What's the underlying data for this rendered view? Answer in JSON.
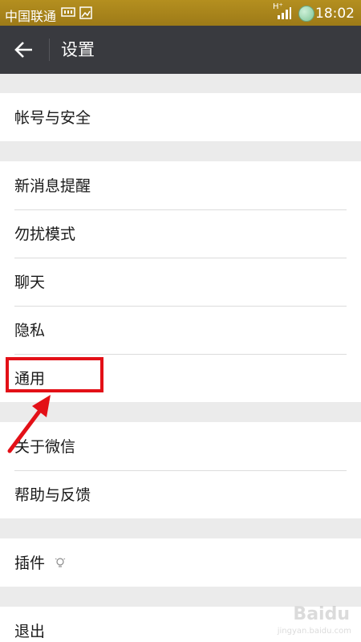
{
  "status_bar": {
    "carrier": "中国联通",
    "network": "H⁺",
    "time": "18:02"
  },
  "header": {
    "title": "设置",
    "back_icon": "arrow-left-icon"
  },
  "settings": {
    "account": "帐号与安全",
    "notifications": "新消息提醒",
    "do_not_disturb": "勿扰模式",
    "chat": "聊天",
    "privacy": "隐私",
    "general": "通用",
    "about": "关于微信",
    "help": "帮助与反馈",
    "plugins": "插件",
    "logout": "退出"
  },
  "watermark": {
    "brand": "Baidu",
    "sub": "jingyan.baidu.com"
  },
  "colors": {
    "status_bar": "#a4811b",
    "header": "#393a3f",
    "highlight": "#e31017",
    "background": "#ebebeb"
  }
}
